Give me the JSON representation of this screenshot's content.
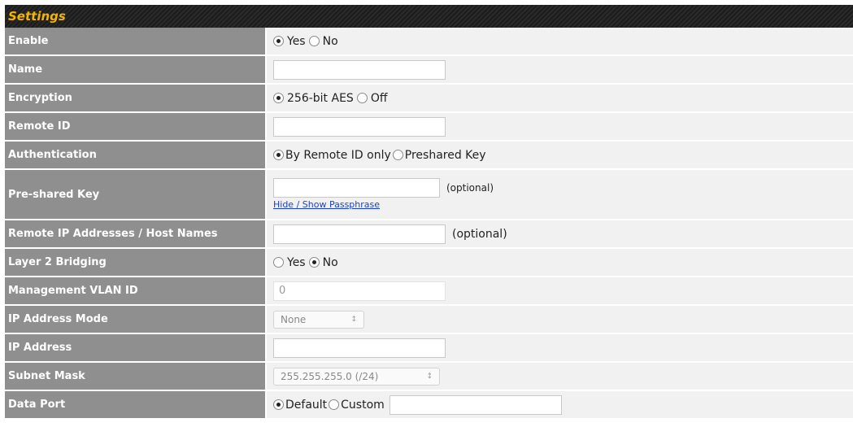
{
  "header": {
    "title": "Settings"
  },
  "rows": {
    "enable": {
      "label": "Enable",
      "opt1": "Yes",
      "opt2": "No"
    },
    "name": {
      "label": "Name",
      "value": ""
    },
    "encryption": {
      "label": "Encryption",
      "opt1": "256-bit AES",
      "opt2": "Off"
    },
    "remote_id": {
      "label": "Remote ID",
      "value": ""
    },
    "authentication": {
      "label": "Authentication",
      "opt1": "By Remote ID only",
      "opt2": "Preshared Key"
    },
    "preshared_key": {
      "label": "Pre-shared Key",
      "value": "",
      "hint": "(optional)",
      "link": "Hide / Show Passphrase"
    },
    "remote_ip": {
      "label": "Remote IP Addresses / Host Names",
      "value": "",
      "hint": "(optional)"
    },
    "layer2": {
      "label": "Layer 2 Bridging",
      "opt1": "Yes",
      "opt2": "No"
    },
    "mgmt_vlan": {
      "label": "Management VLAN ID",
      "value": "0"
    },
    "ip_mode": {
      "label": "IP Address Mode",
      "selected": "None"
    },
    "ip_address": {
      "label": "IP Address",
      "value": ""
    },
    "subnet_mask": {
      "label": "Subnet Mask",
      "selected": "255.255.255.0 (/24)"
    },
    "data_port": {
      "label": "Data Port",
      "opt1": "Default",
      "opt2": "Custom",
      "value": ""
    }
  },
  "state": {
    "enable": "Yes",
    "encryption": "256-bit AES",
    "authentication": "By Remote ID only",
    "layer2": "No",
    "data_port": "Default"
  },
  "icons": {
    "select_arrow": "updown-chevron-icon"
  },
  "colors": {
    "header_text": "#f4b400",
    "label_bg": "#8f8f8f",
    "value_bg": "#f1f1f1",
    "link": "#1a3fd4"
  }
}
